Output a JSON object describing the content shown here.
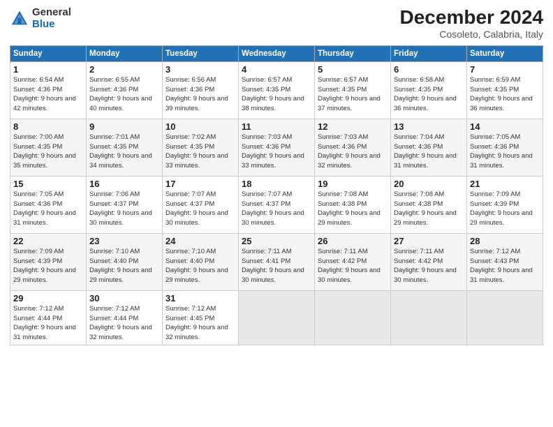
{
  "header": {
    "logo_general": "General",
    "logo_blue": "Blue",
    "month_title": "December 2024",
    "subtitle": "Cosoleto, Calabria, Italy"
  },
  "days_of_week": [
    "Sunday",
    "Monday",
    "Tuesday",
    "Wednesday",
    "Thursday",
    "Friday",
    "Saturday"
  ],
  "weeks": [
    [
      {
        "day": "1",
        "sunrise": "6:54 AM",
        "sunset": "4:36 PM",
        "daylight": "9 hours and 42 minutes."
      },
      {
        "day": "2",
        "sunrise": "6:55 AM",
        "sunset": "4:36 PM",
        "daylight": "9 hours and 40 minutes."
      },
      {
        "day": "3",
        "sunrise": "6:56 AM",
        "sunset": "4:36 PM",
        "daylight": "9 hours and 39 minutes."
      },
      {
        "day": "4",
        "sunrise": "6:57 AM",
        "sunset": "4:35 PM",
        "daylight": "9 hours and 38 minutes."
      },
      {
        "day": "5",
        "sunrise": "6:57 AM",
        "sunset": "4:35 PM",
        "daylight": "9 hours and 37 minutes."
      },
      {
        "day": "6",
        "sunrise": "6:58 AM",
        "sunset": "4:35 PM",
        "daylight": "9 hours and 36 minutes."
      },
      {
        "day": "7",
        "sunrise": "6:59 AM",
        "sunset": "4:35 PM",
        "daylight": "9 hours and 36 minutes."
      }
    ],
    [
      {
        "day": "8",
        "sunrise": "7:00 AM",
        "sunset": "4:35 PM",
        "daylight": "9 hours and 35 minutes."
      },
      {
        "day": "9",
        "sunrise": "7:01 AM",
        "sunset": "4:35 PM",
        "daylight": "9 hours and 34 minutes."
      },
      {
        "day": "10",
        "sunrise": "7:02 AM",
        "sunset": "4:35 PM",
        "daylight": "9 hours and 33 minutes."
      },
      {
        "day": "11",
        "sunrise": "7:03 AM",
        "sunset": "4:36 PM",
        "daylight": "9 hours and 33 minutes."
      },
      {
        "day": "12",
        "sunrise": "7:03 AM",
        "sunset": "4:36 PM",
        "daylight": "9 hours and 32 minutes."
      },
      {
        "day": "13",
        "sunrise": "7:04 AM",
        "sunset": "4:36 PM",
        "daylight": "9 hours and 31 minutes."
      },
      {
        "day": "14",
        "sunrise": "7:05 AM",
        "sunset": "4:36 PM",
        "daylight": "9 hours and 31 minutes."
      }
    ],
    [
      {
        "day": "15",
        "sunrise": "7:05 AM",
        "sunset": "4:36 PM",
        "daylight": "9 hours and 31 minutes."
      },
      {
        "day": "16",
        "sunrise": "7:06 AM",
        "sunset": "4:37 PM",
        "daylight": "9 hours and 30 minutes."
      },
      {
        "day": "17",
        "sunrise": "7:07 AM",
        "sunset": "4:37 PM",
        "daylight": "9 hours and 30 minutes."
      },
      {
        "day": "18",
        "sunrise": "7:07 AM",
        "sunset": "4:37 PM",
        "daylight": "9 hours and 30 minutes."
      },
      {
        "day": "19",
        "sunrise": "7:08 AM",
        "sunset": "4:38 PM",
        "daylight": "9 hours and 29 minutes."
      },
      {
        "day": "20",
        "sunrise": "7:08 AM",
        "sunset": "4:38 PM",
        "daylight": "9 hours and 29 minutes."
      },
      {
        "day": "21",
        "sunrise": "7:09 AM",
        "sunset": "4:39 PM",
        "daylight": "9 hours and 29 minutes."
      }
    ],
    [
      {
        "day": "22",
        "sunrise": "7:09 AM",
        "sunset": "4:39 PM",
        "daylight": "9 hours and 29 minutes."
      },
      {
        "day": "23",
        "sunrise": "7:10 AM",
        "sunset": "4:40 PM",
        "daylight": "9 hours and 29 minutes."
      },
      {
        "day": "24",
        "sunrise": "7:10 AM",
        "sunset": "4:40 PM",
        "daylight": "9 hours and 29 minutes."
      },
      {
        "day": "25",
        "sunrise": "7:11 AM",
        "sunset": "4:41 PM",
        "daylight": "9 hours and 30 minutes."
      },
      {
        "day": "26",
        "sunrise": "7:11 AM",
        "sunset": "4:42 PM",
        "daylight": "9 hours and 30 minutes."
      },
      {
        "day": "27",
        "sunrise": "7:11 AM",
        "sunset": "4:42 PM",
        "daylight": "9 hours and 30 minutes."
      },
      {
        "day": "28",
        "sunrise": "7:12 AM",
        "sunset": "4:43 PM",
        "daylight": "9 hours and 31 minutes."
      }
    ],
    [
      {
        "day": "29",
        "sunrise": "7:12 AM",
        "sunset": "4:44 PM",
        "daylight": "9 hours and 31 minutes."
      },
      {
        "day": "30",
        "sunrise": "7:12 AM",
        "sunset": "4:44 PM",
        "daylight": "9 hours and 32 minutes."
      },
      {
        "day": "31",
        "sunrise": "7:12 AM",
        "sunset": "4:45 PM",
        "daylight": "9 hours and 32 minutes."
      },
      null,
      null,
      null,
      null
    ]
  ]
}
